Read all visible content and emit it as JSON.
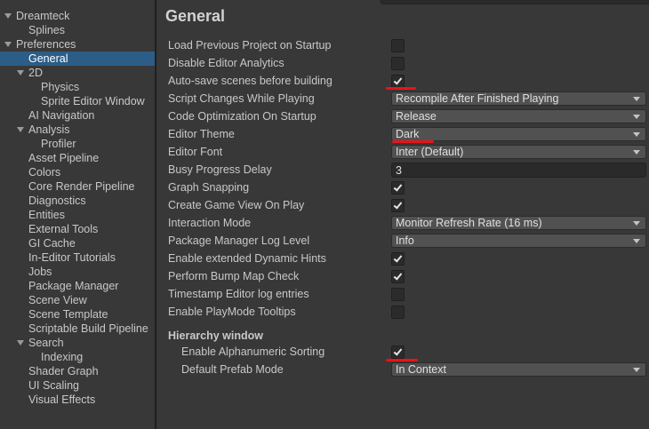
{
  "sidebar": {
    "items": [
      {
        "label": "Dreamteck"
      },
      {
        "label": "Splines"
      },
      {
        "label": "Preferences"
      },
      {
        "label": "General"
      },
      {
        "label": "2D"
      },
      {
        "label": "Physics"
      },
      {
        "label": "Sprite Editor Window"
      },
      {
        "label": "AI Navigation"
      },
      {
        "label": "Analysis"
      },
      {
        "label": "Profiler"
      },
      {
        "label": "Asset Pipeline"
      },
      {
        "label": "Colors"
      },
      {
        "label": "Core Render Pipeline"
      },
      {
        "label": "Diagnostics"
      },
      {
        "label": "Entities"
      },
      {
        "label": "External Tools"
      },
      {
        "label": "GI Cache"
      },
      {
        "label": "In-Editor Tutorials"
      },
      {
        "label": "Jobs"
      },
      {
        "label": "Package Manager"
      },
      {
        "label": "Scene View"
      },
      {
        "label": "Scene Template"
      },
      {
        "label": "Scriptable Build Pipeline"
      },
      {
        "label": "Search"
      },
      {
        "label": "Indexing"
      },
      {
        "label": "Shader Graph"
      },
      {
        "label": "UI Scaling"
      },
      {
        "label": "Visual Effects"
      }
    ],
    "selected": "General"
  },
  "main": {
    "title": "General",
    "settings": [
      {
        "label": "Load Previous Project on Startup",
        "control": "checkbox",
        "checked": false
      },
      {
        "label": "Disable Editor Analytics",
        "control": "checkbox",
        "checked": false
      },
      {
        "label": "Auto-save scenes before building",
        "control": "checkbox",
        "checked": true
      },
      {
        "label": "Script Changes While Playing",
        "control": "dropdown",
        "value": "Recompile After Finished Playing"
      },
      {
        "label": "Code Optimization On Startup",
        "control": "dropdown",
        "value": "Release"
      },
      {
        "label": "Editor Theme",
        "control": "dropdown",
        "value": "Dark"
      },
      {
        "label": "Editor Font",
        "control": "dropdown",
        "value": "Inter (Default)"
      },
      {
        "label": "Busy Progress Delay",
        "control": "textfield",
        "value": "3"
      },
      {
        "label": "Graph Snapping",
        "control": "checkbox",
        "checked": true
      },
      {
        "label": "Create Game View On Play",
        "control": "checkbox",
        "checked": true
      },
      {
        "label": "Interaction Mode",
        "control": "dropdown",
        "value": "Monitor Refresh Rate (16 ms)"
      },
      {
        "label": "Package Manager Log Level",
        "control": "dropdown",
        "value": "Info"
      },
      {
        "label": "Enable extended Dynamic Hints",
        "control": "checkbox",
        "checked": true
      },
      {
        "label": "Perform Bump Map Check",
        "control": "checkbox",
        "checked": true
      },
      {
        "label": "Timestamp Editor log entries",
        "control": "checkbox",
        "checked": false
      },
      {
        "label": "Enable PlayMode Tooltips",
        "control": "checkbox",
        "checked": false
      }
    ],
    "hierarchy": {
      "header": "Hierarchy window",
      "settings": [
        {
          "label": "Enable Alphanumeric Sorting",
          "control": "checkbox",
          "checked": true
        },
        {
          "label": "Default Prefab Mode",
          "control": "dropdown",
          "value": "In Context"
        }
      ]
    }
  },
  "colors": {
    "background": "#383838",
    "selection": "#2c5d87",
    "annotation": "#e8131a"
  }
}
